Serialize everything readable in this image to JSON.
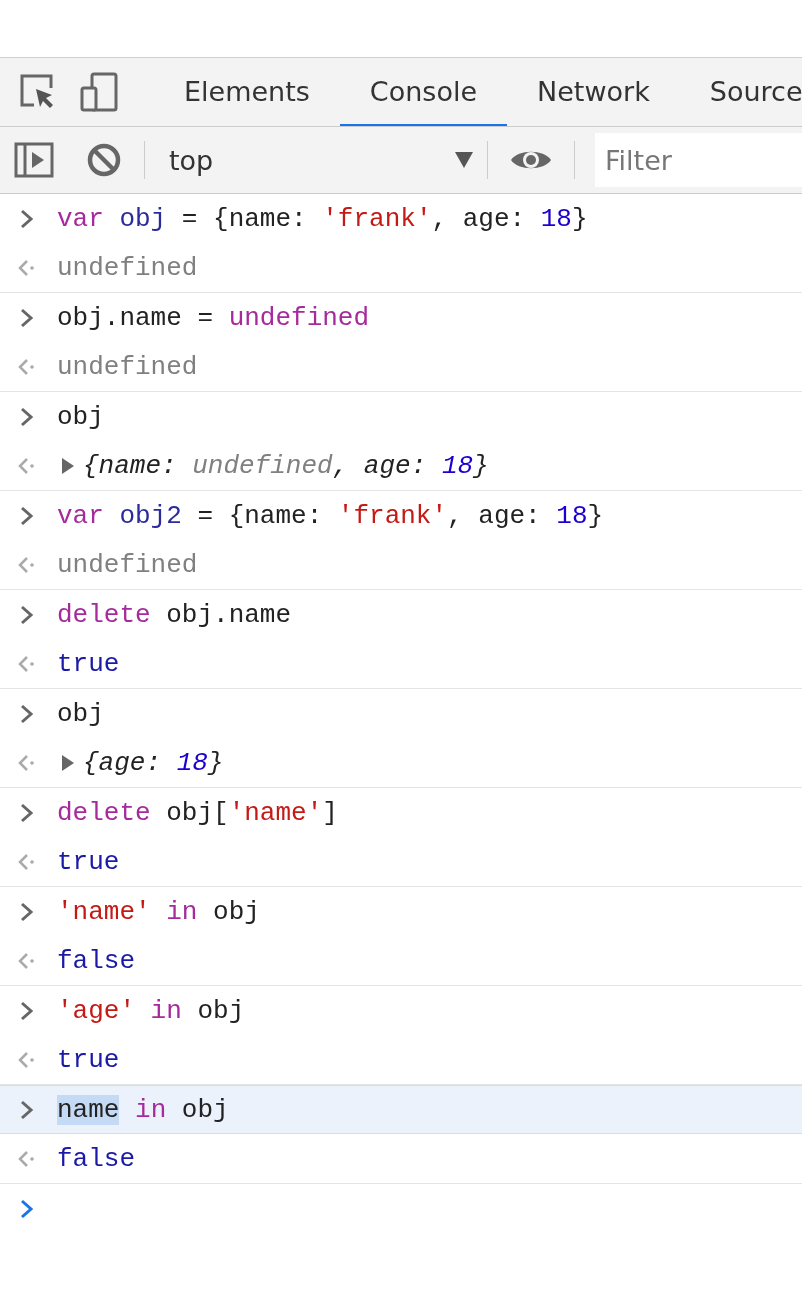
{
  "tabs": [
    {
      "label": "Elements",
      "selected": false
    },
    {
      "label": "Console",
      "selected": true
    },
    {
      "label": "Network",
      "selected": false
    },
    {
      "label": "Source",
      "selected": false
    }
  ],
  "toolbar": {
    "context": "top",
    "filter": {
      "placeholder": "Filter"
    }
  },
  "entries": [
    {
      "selected": false,
      "input": [
        {
          "t": "var",
          "kind": "keyword"
        },
        {
          "t": " obj",
          "kind": "def"
        },
        {
          "t": " = {name: ",
          "kind": "text"
        },
        {
          "t": "'frank'",
          "kind": "string"
        },
        {
          "t": ", age: ",
          "kind": "text"
        },
        {
          "t": "18",
          "kind": "number"
        },
        {
          "t": "}",
          "kind": "text"
        }
      ],
      "output": {
        "kind": "value",
        "tokens": [
          {
            "t": "undefined",
            "kind": "undefined"
          }
        ]
      }
    },
    {
      "selected": false,
      "input": [
        {
          "t": "obj.name = ",
          "kind": "text"
        },
        {
          "t": "undefined",
          "kind": "keyword"
        }
      ],
      "output": {
        "kind": "value",
        "tokens": [
          {
            "t": "undefined",
            "kind": "undefined"
          }
        ]
      }
    },
    {
      "selected": false,
      "input": [
        {
          "t": "obj",
          "kind": "text"
        }
      ],
      "output": {
        "kind": "object",
        "tokens": [
          {
            "t": "{name: ",
            "kind": "text"
          },
          {
            "t": "undefined",
            "kind": "undefined"
          },
          {
            "t": ", age: ",
            "kind": "text"
          },
          {
            "t": "18",
            "kind": "number"
          },
          {
            "t": "}",
            "kind": "text"
          }
        ]
      }
    },
    {
      "selected": false,
      "input": [
        {
          "t": "var",
          "kind": "keyword"
        },
        {
          "t": " obj2",
          "kind": "def"
        },
        {
          "t": " = {name: ",
          "kind": "text"
        },
        {
          "t": "'frank'",
          "kind": "string"
        },
        {
          "t": ", age: ",
          "kind": "text"
        },
        {
          "t": "18",
          "kind": "number"
        },
        {
          "t": "}",
          "kind": "text"
        }
      ],
      "output": {
        "kind": "value",
        "tokens": [
          {
            "t": "undefined",
            "kind": "undefined"
          }
        ]
      }
    },
    {
      "selected": false,
      "input": [
        {
          "t": "delete",
          "kind": "keyword"
        },
        {
          "t": " obj.name",
          "kind": "text"
        }
      ],
      "output": {
        "kind": "value",
        "tokens": [
          {
            "t": "true",
            "kind": "boolean"
          }
        ]
      }
    },
    {
      "selected": false,
      "input": [
        {
          "t": "obj",
          "kind": "text"
        }
      ],
      "output": {
        "kind": "object",
        "tokens": [
          {
            "t": "{age: ",
            "kind": "text"
          },
          {
            "t": "18",
            "kind": "number"
          },
          {
            "t": "}",
            "kind": "text"
          }
        ]
      }
    },
    {
      "selected": false,
      "input": [
        {
          "t": "delete",
          "kind": "keyword"
        },
        {
          "t": " obj[",
          "kind": "text"
        },
        {
          "t": "'name'",
          "kind": "string"
        },
        {
          "t": "]",
          "kind": "text"
        }
      ],
      "output": {
        "kind": "value",
        "tokens": [
          {
            "t": "true",
            "kind": "boolean"
          }
        ]
      }
    },
    {
      "selected": false,
      "input": [
        {
          "t": "'name'",
          "kind": "string"
        },
        {
          "t": " in",
          "kind": "keyword"
        },
        {
          "t": " obj",
          "kind": "text"
        }
      ],
      "output": {
        "kind": "value",
        "tokens": [
          {
            "t": "false",
            "kind": "boolean"
          }
        ]
      }
    },
    {
      "selected": false,
      "input": [
        {
          "t": "'age'",
          "kind": "string"
        },
        {
          "t": " in",
          "kind": "keyword"
        },
        {
          "t": " obj",
          "kind": "text"
        }
      ],
      "output": {
        "kind": "value",
        "tokens": [
          {
            "t": "true",
            "kind": "boolean"
          }
        ]
      }
    },
    {
      "selected": true,
      "input": [
        {
          "t": "name",
          "kind": "selected-text"
        },
        {
          "t": " in",
          "kind": "keyword"
        },
        {
          "t": " obj",
          "kind": "text"
        }
      ],
      "output": {
        "kind": "value",
        "tokens": [
          {
            "t": "false",
            "kind": "boolean"
          }
        ]
      }
    }
  ]
}
